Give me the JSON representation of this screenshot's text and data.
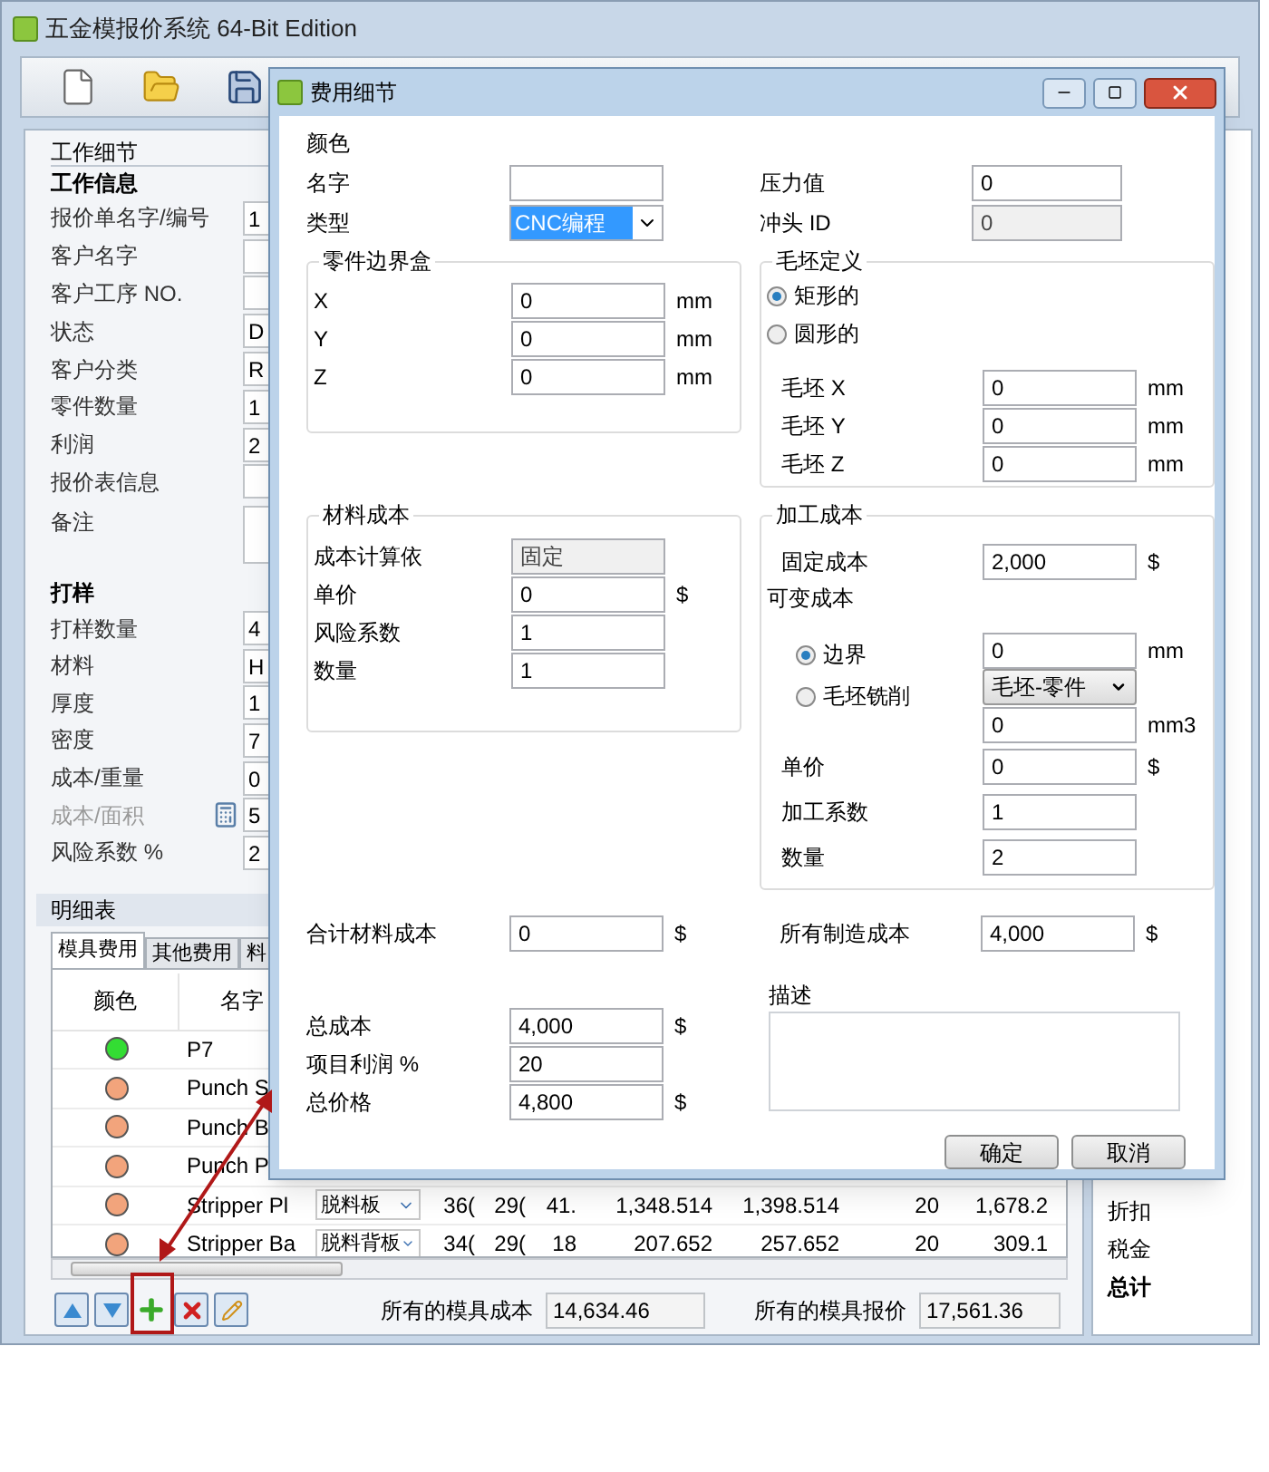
{
  "app": {
    "title": "五金模报价系统 64-Bit Edition"
  },
  "work_panel": {
    "header": "工作细节",
    "info_title": "工作信息",
    "info_fields": [
      {
        "label": "报价单名字/编号",
        "value": "1",
        "kind": "field"
      },
      {
        "label": "客户名字",
        "kind": "field"
      },
      {
        "label": "客户工序 NO.",
        "kind": "field"
      },
      {
        "label": "状态",
        "value": "D",
        "kind": "field"
      },
      {
        "label": "客户分类",
        "value": "R",
        "kind": "field"
      },
      {
        "label": "零件数量",
        "value": "1",
        "kind": "field"
      },
      {
        "label": "利润",
        "value": "2",
        "kind": "field"
      },
      {
        "label": "报价表信息",
        "kind": "field"
      },
      {
        "label": "备注",
        "kind": "memo"
      }
    ],
    "sample_title": "打样",
    "sample_fields": [
      {
        "label": "打样数量",
        "value": "4",
        "disabled": false
      },
      {
        "label": "材料",
        "value": "H",
        "disabled": false
      },
      {
        "label": "厚度",
        "value": "1",
        "disabled": false
      },
      {
        "label": "密度",
        "value": "7",
        "disabled": false
      },
      {
        "label": "成本/重量",
        "value": "0",
        "disabled": false
      },
      {
        "label": "成本/面积",
        "value": "5",
        "disabled": true
      },
      {
        "label": "风险系数 %",
        "value": "2",
        "disabled": false
      }
    ]
  },
  "details": {
    "header": "明细表",
    "tabs": [
      {
        "label": "模具费用",
        "selected": true
      },
      {
        "label": "其他费用",
        "selected": false
      },
      {
        "label": "料",
        "selected": false
      }
    ],
    "columns": [
      "颜色",
      "名字"
    ],
    "rows": [
      {
        "color": "#33dd33",
        "name": "P7"
      },
      {
        "color": "#f2a47c",
        "name": "Punch S"
      },
      {
        "color": "#f2a47c",
        "name": "Punch B"
      },
      {
        "color": "#f2a47c",
        "name": "Punch P"
      },
      {
        "color": "#f2a47c",
        "name": "Stripper Pl",
        "type": "脱料板",
        "cells": [
          "36(",
          "29(",
          "41.",
          "1,348.514",
          "1,398.514",
          "20",
          "1,678.2"
        ]
      },
      {
        "color": "#f2a47c",
        "name": "Stripper Ba",
        "type": "脱料背板",
        "cells": [
          "34(",
          "29(",
          "18",
          "207.652",
          "257.652",
          "20",
          "309.1"
        ]
      }
    ],
    "total_cost_label": "所有的模具成本",
    "total_cost": "14,634.46",
    "total_price_label": "所有的模具报价",
    "total_price": "17,561.36"
  },
  "summary": [
    {
      "label": "折扣",
      "bold": false
    },
    {
      "label": "税金",
      "bold": false
    },
    {
      "label": "总计",
      "bold": true
    }
  ],
  "dialog": {
    "title": "费用细节",
    "color_label": "颜色",
    "name": {
      "label": "名字"
    },
    "type": {
      "label": "类型",
      "value": "CNC编程"
    },
    "pressure": {
      "label": "压力值",
      "value": "0"
    },
    "punch": {
      "label": "冲头 ID",
      "value": "0",
      "disabled": true
    },
    "part_box": {
      "title": "零件边界盒",
      "rows": [
        {
          "label": "X",
          "value": "0",
          "unit": "mm"
        },
        {
          "label": "Y",
          "value": "0",
          "unit": "mm"
        },
        {
          "label": "Z",
          "value": "0",
          "unit": "mm"
        }
      ]
    },
    "blank": {
      "title": "毛坯定义",
      "options": [
        {
          "label": "矩形的",
          "selected": true
        },
        {
          "label": "圆形的",
          "selected": false
        }
      ],
      "rows": [
        {
          "label": "毛坯 X",
          "value": "0",
          "unit": "mm"
        },
        {
          "label": "毛坯 Y",
          "value": "0",
          "unit": "mm"
        },
        {
          "label": "毛坯 Z",
          "value": "0",
          "unit": "mm"
        }
      ]
    },
    "material": {
      "title": "材料成本",
      "rows": [
        {
          "label": "成本计算依",
          "value": "固定",
          "disabled": true
        },
        {
          "label": "单价",
          "value": "0",
          "unit": "$",
          "disabled": false
        },
        {
          "label": "风险系数",
          "value": "1",
          "disabled": false
        },
        {
          "label": "数量",
          "value": "1",
          "disabled": false
        }
      ]
    },
    "machining": {
      "title": "加工成本",
      "fixed": {
        "label": "固定成本",
        "value": "2,000",
        "unit": "$"
      },
      "variable_label": "可变成本",
      "options": [
        {
          "label": "边界",
          "selected": true
        },
        {
          "label": "毛坯铣削",
          "selected": false
        }
      ],
      "edge": {
        "value": "0",
        "unit": "mm"
      },
      "mill_select": "毛坯-零件",
      "volume": {
        "value": "0",
        "unit": "mm3"
      },
      "rows": [
        {
          "label": "单价",
          "value": "0",
          "unit": "$"
        },
        {
          "label": "加工系数",
          "value": "1"
        },
        {
          "label": "数量",
          "value": "2"
        }
      ]
    },
    "material_total": {
      "label": "合计材料成本",
      "value": "0",
      "unit": "$"
    },
    "manufacturing_total": {
      "label": "所有制造成本",
      "value": "4,000",
      "unit": "$"
    },
    "totals": [
      {
        "label": "总成本",
        "value": "4,000",
        "unit": "$"
      },
      {
        "label": "项目利润 %",
        "value": "20"
      },
      {
        "label": "总价格",
        "value": "4,800",
        "unit": "$"
      }
    ],
    "description": {
      "label": "描述"
    },
    "buttons": [
      "确定",
      "取消"
    ]
  }
}
